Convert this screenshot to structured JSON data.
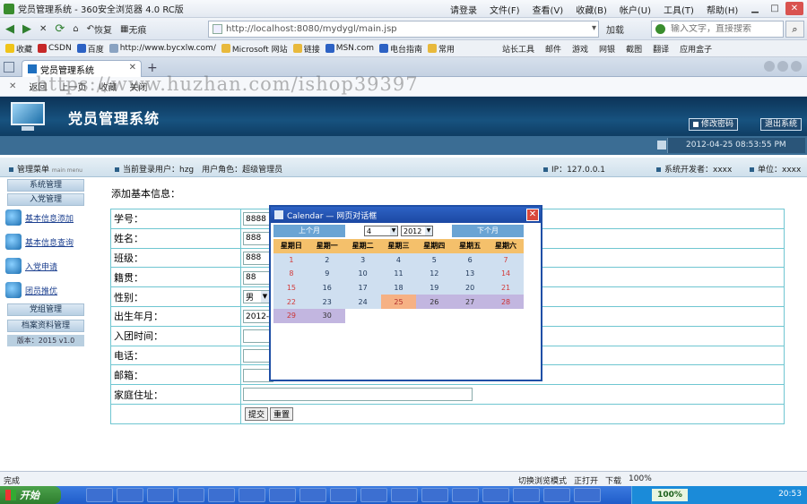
{
  "browser": {
    "window_title": "党员管理系统 - 360安全浏览器 4.0 RC版",
    "menus": [
      "请登录",
      "文件(F)",
      "查看(V)",
      "收藏(B)",
      "帐户(U)",
      "工具(T)",
      "帮助(H)"
    ],
    "nav": {
      "recover": "恢复",
      "nothing": "无痕"
    },
    "url": "http://localhost:8080/mydygl/main.jsp",
    "addon": "加载",
    "search_placeholder": "输入文字，直接搜索",
    "favorites": [
      "收藏",
      "CSDN",
      "百度",
      "http://www.bycxlw.com/",
      "Microsoft 网站",
      "链接",
      "MSN.com",
      "电台指南",
      "常用"
    ],
    "favorites_right": [
      "站长工具",
      "邮件",
      "游戏",
      "网银",
      "截图",
      "翻译",
      "应用盒子"
    ],
    "tab_title": "党员管理系统",
    "cmd": [
      "返回",
      "上一页",
      "收藏",
      "关闭"
    ],
    "watermark": "https://www.huzhan.com/ishop39397",
    "status_left": "完成",
    "status_right": [
      "切换浏览模式",
      "正打开",
      "下载",
      "100%"
    ]
  },
  "header": {
    "title": "党员管理系统",
    "change_pwd": "修改密码",
    "logout": "退出系统",
    "datetime": "2012-04-25 08:53:55 PM"
  },
  "infobar": {
    "menu_label": "管理菜单",
    "menu_sub": "main menu",
    "user": "当前登录用户：hzg　用户角色：超级管理员",
    "ip": "IP：127.0.0.1",
    "developer": "系统开发者：xxxx",
    "unit": "单位：xxxx"
  },
  "sidebar": {
    "system_mgmt": "系统管理",
    "party_mgmt": "入党管理",
    "links": [
      "基本信息添加",
      "基本信息查询",
      "入党申请",
      "团员推优"
    ],
    "org_mgmt": "党组管理",
    "archive_mgmt": "档案资料管理",
    "version": "版本：2015 v1.0"
  },
  "form": {
    "caption": "添加基本信息：",
    "rows": [
      {
        "label": "学号：",
        "value": "8888"
      },
      {
        "label": "姓名：",
        "value": "888"
      },
      {
        "label": "班级：",
        "value": "888"
      },
      {
        "label": "籍贯：",
        "value": "88"
      },
      {
        "label": "性别：",
        "value": "男"
      },
      {
        "label": "出生年月：",
        "value": "2012-"
      },
      {
        "label": "入团时间：",
        "value": ""
      },
      {
        "label": "电话：",
        "value": ""
      },
      {
        "label": "邮箱：",
        "value": ""
      },
      {
        "label": "家庭住址：",
        "value": ""
      }
    ],
    "submit": "提交",
    "reset": "重置"
  },
  "calendar": {
    "title": "Calendar —  网页对话框",
    "prev": "上个月",
    "next": "下个月",
    "month": "4",
    "year": "2012",
    "weekdays": [
      "星期日",
      "星期一",
      "星期二",
      "星期三",
      "星期四",
      "星期五",
      "星期六"
    ],
    "weeks": [
      [
        "1",
        "2",
        "3",
        "4",
        "5",
        "6",
        "7"
      ],
      [
        "8",
        "9",
        "10",
        "11",
        "12",
        "13",
        "14"
      ],
      [
        "15",
        "16",
        "17",
        "18",
        "19",
        "20",
        "21"
      ],
      [
        "22",
        "23",
        "24",
        "25",
        "26",
        "27",
        "28"
      ],
      [
        "29",
        "30",
        "",
        "",
        "",
        "",
        ""
      ]
    ],
    "today": "25"
  },
  "taskbar": {
    "start": "开始",
    "percent": "100%",
    "clock": "20:53"
  }
}
